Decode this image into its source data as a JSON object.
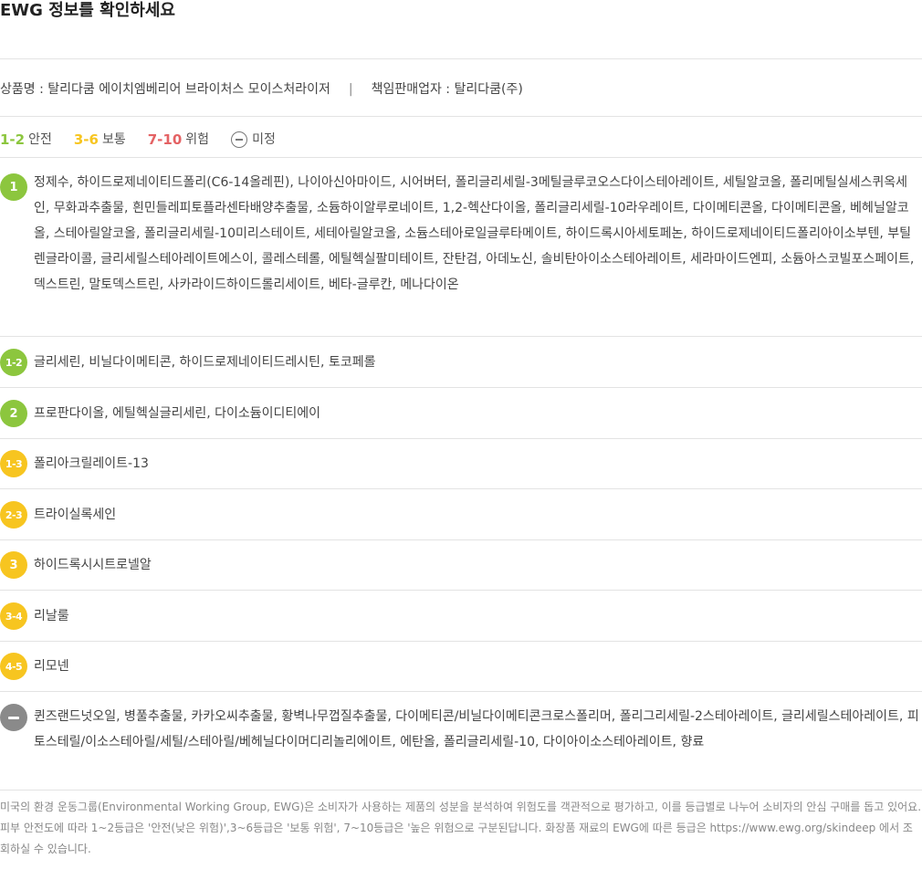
{
  "title": "EWG 정보를 확인하세요",
  "product": {
    "name_text": "상품명 : 탈리다쿰 에이치엠베리어 브라이처스 모이스처라이저",
    "separator": "|",
    "seller_text": "책임판매업자 : 탈리다쿰(주)"
  },
  "legend": {
    "safe_range": "1-2",
    "safe_label": "안전",
    "normal_range": "3-6",
    "normal_label": "보통",
    "risk_range": "7-10",
    "risk_label": "위험",
    "undefined_label": "미정"
  },
  "colors": {
    "safe": "#8cc63e",
    "normal": "#f7c520",
    "risk": "#e46264",
    "undefined": "#8a8a8a"
  },
  "rows": [
    {
      "grade": "1",
      "ingredients": "정제수, 하이드로제네이티드폴리(C6-14올레핀), 나이아신아마이드, 시어버터, 폴리글리세릴-3메틸글루코오스다이스테아레이트, 세틸알코올, 폴리메틸실세스퀴옥세인, 무화과추출물, 흰민들레피토플라센타배양추출물, 소듐하이알루로네이트, 1,2-헥산다이올, 폴리글리세릴-10라우레이트, 다이메티콘올, 다이메티콘올, 베헤닐알코올, 스테아릴알코올, 폴리글리세릴-10미리스테이트, 세테아릴알코올, 소듐스테아로일글루타메이트, 하이드록시아세토페논, 하이드로제네이티드폴리아이소부텐, 부틸렌글라이콜, 글리세릴스테아레이트에스이, 콜레스테롤, 에틸헥실팔미테이트, 잔탄검, 아데노신, 솔비탄아이소스테아레이트, 세라마이드엔피, 소듐아스코빌포스페이트, 덱스트린, 말토덱스트린, 사카라이드하이드롤리세이트, 베타-글루칸, 메나다이온"
    },
    {
      "grade": "1-2",
      "ingredients": "글리세린, 비닐다이메티콘, 하이드로제네이티드레시틴, 토코페롤"
    },
    {
      "grade": "2",
      "ingredients": "프로판다이올, 에틸헥실글리세린, 다이소듐이디티에이"
    },
    {
      "grade": "1-3",
      "ingredients": "폴리아크릴레이트-13"
    },
    {
      "grade": "2-3",
      "ingredients": "트라이실록세인"
    },
    {
      "grade": "3",
      "ingredients": "하이드록시시트로넬알"
    },
    {
      "grade": "3-4",
      "ingredients": "리날룰"
    },
    {
      "grade": "4-5",
      "ingredients": "리모넨"
    },
    {
      "grade": "",
      "ingredients": "퀸즈랜드넛오일, 병풀추출물, 카카오씨추출물, 황벽나무껍질추출물, 다이메티콘/비닐다이메티콘크로스폴리머, 폴리그리세릴-2스테아레이트, 글리세릴스테아레이트, 피토스테릴/이소스테아릴/세틸/스테아릴/베헤닐다이머디리놀리에이트, 에탄올, 폴리글리세릴-10, 다이아이소스테아레이트, 향료"
    }
  ],
  "footnote": "미국의 환경 운동그룹(Environmental Working Group, EWG)은 소비자가 사용하는 제품의 성분을 분석하여 위험도를 객관적으로 평가하고, 이를 등급별로 나누어 소비자의 안심 구매를 돕고 있어요. 피부 안전도에 따라 1~2등급은 '안전(낮은 위험)',3~6등급은 '보통 위험', 7~10등급은 '높은 위험으로 구분된답니다. 화장품 재료의 EWG에 따른 등급은 https://www.ewg.org/skindeep 에서 조회하실 수 있습니다."
}
